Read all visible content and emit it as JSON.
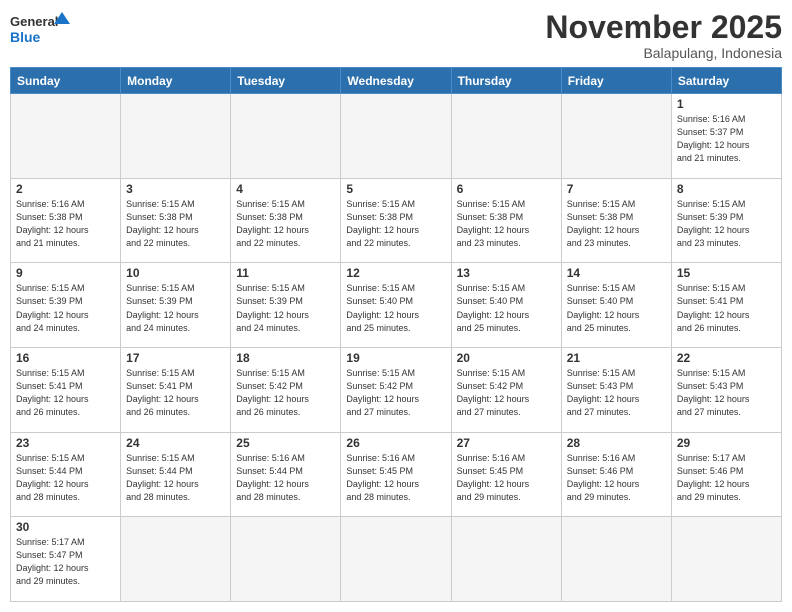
{
  "logo": {
    "general": "General",
    "blue": "Blue"
  },
  "header": {
    "month": "November 2025",
    "location": "Balapulang, Indonesia"
  },
  "weekdays": [
    "Sunday",
    "Monday",
    "Tuesday",
    "Wednesday",
    "Thursday",
    "Friday",
    "Saturday"
  ],
  "weeks": [
    [
      {
        "day": "",
        "info": ""
      },
      {
        "day": "",
        "info": ""
      },
      {
        "day": "",
        "info": ""
      },
      {
        "day": "",
        "info": ""
      },
      {
        "day": "",
        "info": ""
      },
      {
        "day": "",
        "info": ""
      },
      {
        "day": "1",
        "info": "Sunrise: 5:16 AM\nSunset: 5:37 PM\nDaylight: 12 hours\nand 21 minutes."
      }
    ],
    [
      {
        "day": "2",
        "info": "Sunrise: 5:16 AM\nSunset: 5:38 PM\nDaylight: 12 hours\nand 21 minutes."
      },
      {
        "day": "3",
        "info": "Sunrise: 5:15 AM\nSunset: 5:38 PM\nDaylight: 12 hours\nand 22 minutes."
      },
      {
        "day": "4",
        "info": "Sunrise: 5:15 AM\nSunset: 5:38 PM\nDaylight: 12 hours\nand 22 minutes."
      },
      {
        "day": "5",
        "info": "Sunrise: 5:15 AM\nSunset: 5:38 PM\nDaylight: 12 hours\nand 22 minutes."
      },
      {
        "day": "6",
        "info": "Sunrise: 5:15 AM\nSunset: 5:38 PM\nDaylight: 12 hours\nand 23 minutes."
      },
      {
        "day": "7",
        "info": "Sunrise: 5:15 AM\nSunset: 5:38 PM\nDaylight: 12 hours\nand 23 minutes."
      },
      {
        "day": "8",
        "info": "Sunrise: 5:15 AM\nSunset: 5:39 PM\nDaylight: 12 hours\nand 23 minutes."
      }
    ],
    [
      {
        "day": "9",
        "info": "Sunrise: 5:15 AM\nSunset: 5:39 PM\nDaylight: 12 hours\nand 24 minutes."
      },
      {
        "day": "10",
        "info": "Sunrise: 5:15 AM\nSunset: 5:39 PM\nDaylight: 12 hours\nand 24 minutes."
      },
      {
        "day": "11",
        "info": "Sunrise: 5:15 AM\nSunset: 5:39 PM\nDaylight: 12 hours\nand 24 minutes."
      },
      {
        "day": "12",
        "info": "Sunrise: 5:15 AM\nSunset: 5:40 PM\nDaylight: 12 hours\nand 25 minutes."
      },
      {
        "day": "13",
        "info": "Sunrise: 5:15 AM\nSunset: 5:40 PM\nDaylight: 12 hours\nand 25 minutes."
      },
      {
        "day": "14",
        "info": "Sunrise: 5:15 AM\nSunset: 5:40 PM\nDaylight: 12 hours\nand 25 minutes."
      },
      {
        "day": "15",
        "info": "Sunrise: 5:15 AM\nSunset: 5:41 PM\nDaylight: 12 hours\nand 26 minutes."
      }
    ],
    [
      {
        "day": "16",
        "info": "Sunrise: 5:15 AM\nSunset: 5:41 PM\nDaylight: 12 hours\nand 26 minutes."
      },
      {
        "day": "17",
        "info": "Sunrise: 5:15 AM\nSunset: 5:41 PM\nDaylight: 12 hours\nand 26 minutes."
      },
      {
        "day": "18",
        "info": "Sunrise: 5:15 AM\nSunset: 5:42 PM\nDaylight: 12 hours\nand 26 minutes."
      },
      {
        "day": "19",
        "info": "Sunrise: 5:15 AM\nSunset: 5:42 PM\nDaylight: 12 hours\nand 27 minutes."
      },
      {
        "day": "20",
        "info": "Sunrise: 5:15 AM\nSunset: 5:42 PM\nDaylight: 12 hours\nand 27 minutes."
      },
      {
        "day": "21",
        "info": "Sunrise: 5:15 AM\nSunset: 5:43 PM\nDaylight: 12 hours\nand 27 minutes."
      },
      {
        "day": "22",
        "info": "Sunrise: 5:15 AM\nSunset: 5:43 PM\nDaylight: 12 hours\nand 27 minutes."
      }
    ],
    [
      {
        "day": "23",
        "info": "Sunrise: 5:15 AM\nSunset: 5:44 PM\nDaylight: 12 hours\nand 28 minutes."
      },
      {
        "day": "24",
        "info": "Sunrise: 5:15 AM\nSunset: 5:44 PM\nDaylight: 12 hours\nand 28 minutes."
      },
      {
        "day": "25",
        "info": "Sunrise: 5:16 AM\nSunset: 5:44 PM\nDaylight: 12 hours\nand 28 minutes."
      },
      {
        "day": "26",
        "info": "Sunrise: 5:16 AM\nSunset: 5:45 PM\nDaylight: 12 hours\nand 28 minutes."
      },
      {
        "day": "27",
        "info": "Sunrise: 5:16 AM\nSunset: 5:45 PM\nDaylight: 12 hours\nand 29 minutes."
      },
      {
        "day": "28",
        "info": "Sunrise: 5:16 AM\nSunset: 5:46 PM\nDaylight: 12 hours\nand 29 minutes."
      },
      {
        "day": "29",
        "info": "Sunrise: 5:17 AM\nSunset: 5:46 PM\nDaylight: 12 hours\nand 29 minutes."
      }
    ],
    [
      {
        "day": "30",
        "info": "Sunrise: 5:17 AM\nSunset: 5:47 PM\nDaylight: 12 hours\nand 29 minutes."
      },
      {
        "day": "",
        "info": ""
      },
      {
        "day": "",
        "info": ""
      },
      {
        "day": "",
        "info": ""
      },
      {
        "day": "",
        "info": ""
      },
      {
        "day": "",
        "info": ""
      },
      {
        "day": "",
        "info": ""
      }
    ]
  ]
}
